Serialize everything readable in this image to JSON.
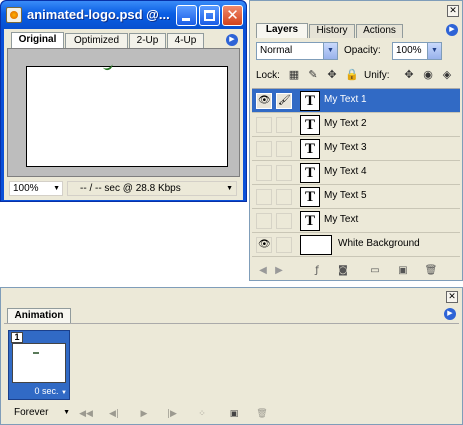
{
  "document": {
    "title": "animated-logo.psd @...",
    "tabs": [
      "Original",
      "Optimized",
      "2-Up",
      "4-Up"
    ],
    "active_tab": "Original",
    "zoom": "100%",
    "download_info": "-- / -- sec @ 28.8 Kbps"
  },
  "layers_panel": {
    "tabs": [
      "Layers",
      "History",
      "Actions"
    ],
    "active_tab": "Layers",
    "blend_mode": "Normal",
    "opacity_label": "Opacity:",
    "opacity_value": "100%",
    "lock_label": "Lock:",
    "unify_label": "Unify:",
    "layers": [
      {
        "name": "My Text 1",
        "type": "text",
        "visible": true,
        "selected": true,
        "thumb": "T"
      },
      {
        "name": "My Text 2",
        "type": "text",
        "visible": false,
        "selected": false,
        "thumb": "T"
      },
      {
        "name": "My Text 3",
        "type": "text",
        "visible": false,
        "selected": false,
        "thumb": "T"
      },
      {
        "name": "My Text 4",
        "type": "text",
        "visible": false,
        "selected": false,
        "thumb": "T"
      },
      {
        "name": "My Text 5",
        "type": "text",
        "visible": false,
        "selected": false,
        "thumb": "T"
      },
      {
        "name": "My Text",
        "type": "text",
        "visible": false,
        "selected": false,
        "thumb": "T"
      },
      {
        "name": "White Background",
        "type": "raster",
        "visible": true,
        "selected": false,
        "thumb": ""
      }
    ]
  },
  "animation_panel": {
    "tab": "Animation",
    "frames": [
      {
        "number": "1",
        "delay": "0 sec."
      }
    ],
    "loop": "Forever"
  },
  "icons": {
    "eye": "eye-icon",
    "brush": "brush-icon"
  }
}
